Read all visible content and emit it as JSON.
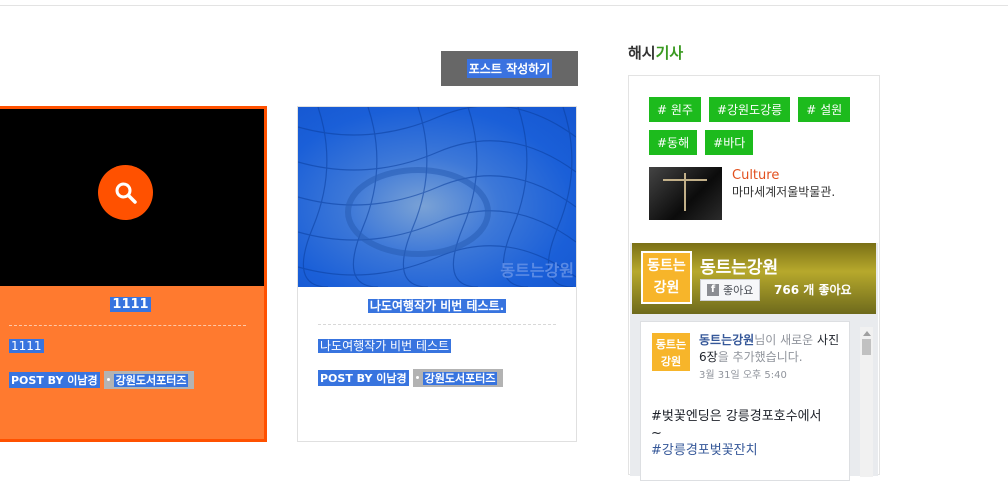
{
  "write_post": {
    "label": "포스트 작성하기"
  },
  "cards": [
    {
      "title": "1111",
      "excerpt": "1111",
      "author": "POST BY 이남경",
      "category": "강원도서포터즈",
      "background": "#ff7a2f",
      "border": "#ff5100"
    },
    {
      "title": "나도여행작가 비번 테스트.",
      "excerpt": "나도여행작가 비번 테스트",
      "author": "POST BY 이남경",
      "category": "강원도서포터즈",
      "watermark": "동트는강원"
    }
  ],
  "sidebar": {
    "heading_prefix": "해시",
    "heading_accent": "기사",
    "tags": [
      "# 원주",
      "#강원도강릉",
      "# 설원",
      "#동해",
      "#바다"
    ],
    "tag_color": "#1dbb1d",
    "post": {
      "category": "Culture",
      "title": "마마세계저울박물관."
    }
  },
  "facebook": {
    "page_name": "동트는강원",
    "logo_text": "동트는 강원",
    "like_label": "좋아요",
    "like_count": "766 개 좋아요",
    "post": {
      "name": "동트는강원",
      "action_pre": "님이 새로운 ",
      "action_bold": "사진 6장",
      "action_post": "을 추가했습니다.",
      "date": "3월 31일 오후 5:40",
      "line1": "#벚꽃엔딩은 강릉경포호수에서",
      "line2": "~",
      "line3": "#강릉경포벚꽃잔치"
    }
  }
}
